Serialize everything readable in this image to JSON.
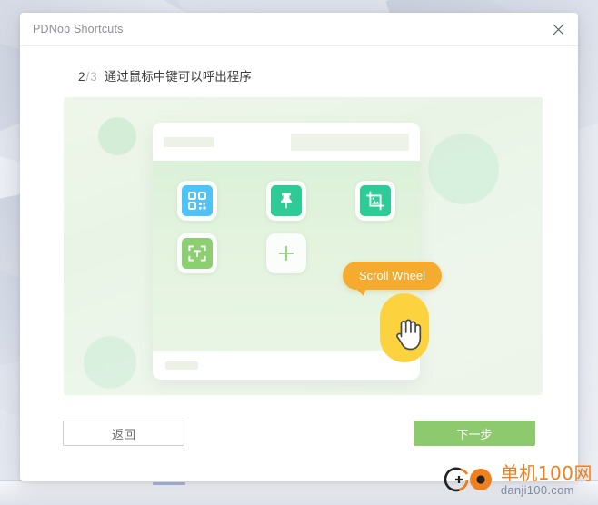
{
  "window": {
    "title": "PDNob Shortcuts",
    "close_icon": "close-icon"
  },
  "step": {
    "current": "2",
    "separator": "/",
    "total": "3",
    "description": "通过鼠标中键可以呼出程序"
  },
  "illustration": {
    "tooltip_label": "Scroll Wheel",
    "cursor_icon": "hand-pointer-icon",
    "tiles": [
      {
        "name": "qr-code-icon",
        "color": "#4FC3F7"
      },
      {
        "name": "pin-icon",
        "color": "#2ECB96"
      },
      {
        "name": "image-crop-icon",
        "color": "#2ECB96"
      },
      {
        "name": "ocr-text-icon",
        "color": "#8ECE73"
      },
      {
        "name": "add-plus-icon",
        "color": "#7FC96A"
      }
    ]
  },
  "footer": {
    "back_label": "返回",
    "next_label": "下一步"
  },
  "watermark": {
    "name_cn": "单机100网",
    "name_en": "danji100.com"
  },
  "colors": {
    "accent_green": "#8cca6d",
    "tooltip_orange": "#f5ab2d",
    "cursor_yellow": "#fdd23f"
  }
}
